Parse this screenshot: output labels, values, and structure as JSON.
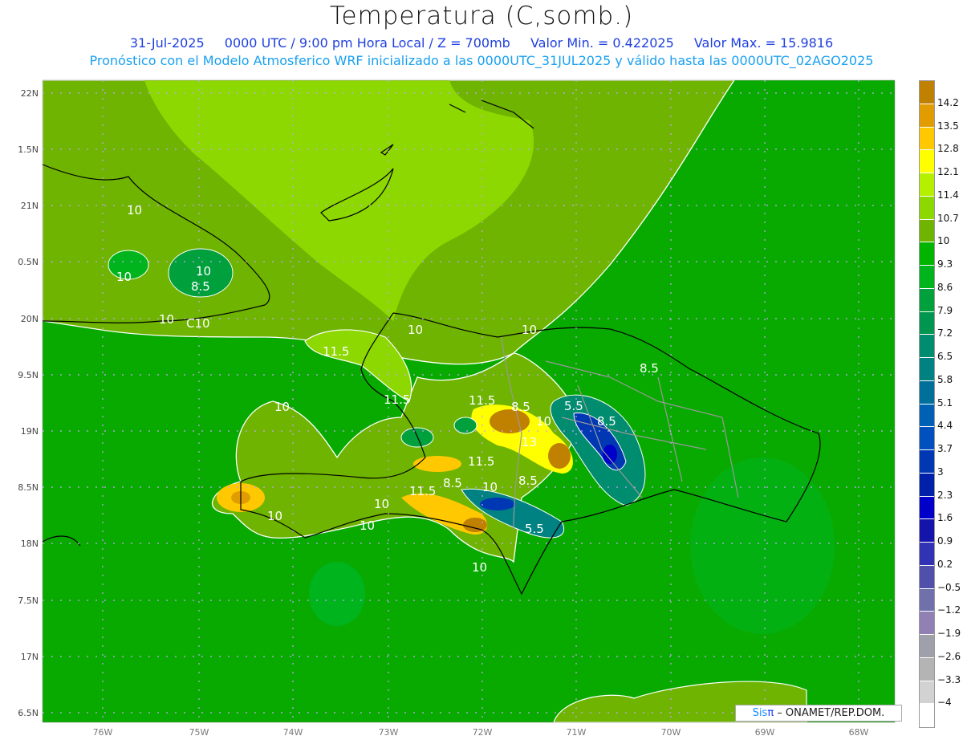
{
  "title": "Temperatura (C,somb.)",
  "subtitle": {
    "date": "31-Jul-2025",
    "time": "0000 UTC / 9:00 pm Hora Local / Z = 700mb",
    "min": "Valor Min. = 0.422025",
    "max": "Valor Max. = 15.9816"
  },
  "forecast_line": "Pronóstico con el Modelo Atmosferico WRF inicializado a las 0000UTC_31JUL2025 y válido hasta las  0000UTC_02AGO2025",
  "lat_labels": [
    "22N",
    "1.5N",
    "21N",
    "0.5N",
    "20N",
    "9.5N",
    "19N",
    "8.5N",
    "18N",
    "7.5N",
    "17N",
    "6.5N"
  ],
  "lon_labels": [
    "76W",
    "75W",
    "74W",
    "73W",
    "72W",
    "71W",
    "70W",
    "69W",
    "68W"
  ],
  "colorbar": {
    "labels": [
      "14.2",
      "13.5",
      "12.8",
      "12.1",
      "11.4",
      "10.7",
      "10",
      "9.3",
      "8.6",
      "7.9",
      "7.2",
      "6.5",
      "5.8",
      "5.1",
      "4.4",
      "3.7",
      "3",
      "2.3",
      "1.6",
      "0.9",
      "0.2",
      "−0.5",
      "−1.2",
      "−1.9",
      "−2.6",
      "−3.3",
      "−4"
    ],
    "colors": [
      "#c08000",
      "#e09c00",
      "#ffc800",
      "#ffff00",
      "#b4f000",
      "#8cd800",
      "#6eb400",
      "#00b400",
      "#00b41e",
      "#00a03c",
      "#009650",
      "#008c6e",
      "#008282",
      "#00709a",
      "#0060b4",
      "#0050be",
      "#0038b4",
      "#0020aa",
      "#0000c8",
      "#1414aa",
      "#3232b4",
      "#5050aa",
      "#7070aa",
      "#9080b4",
      "#a0a0aa",
      "#b4b4b4",
      "#d2d2d2",
      "#ffffff"
    ]
  },
  "contour_labels": [
    "10",
    "10",
    "10",
    "8.5",
    "10",
    "C10",
    "10",
    "11.5",
    "11.5",
    "10",
    "11.5",
    "8.5",
    "10",
    "5.5",
    "8.5",
    "11.5",
    "13",
    "8.5",
    "11.5",
    "8.5",
    "10",
    "5.5",
    "10",
    "10",
    "10",
    "10",
    "10",
    "8.5"
  ],
  "credit": {
    "sis": "Sis",
    "pi": "π",
    "rest": " – ONAMET/REP.DOM."
  }
}
